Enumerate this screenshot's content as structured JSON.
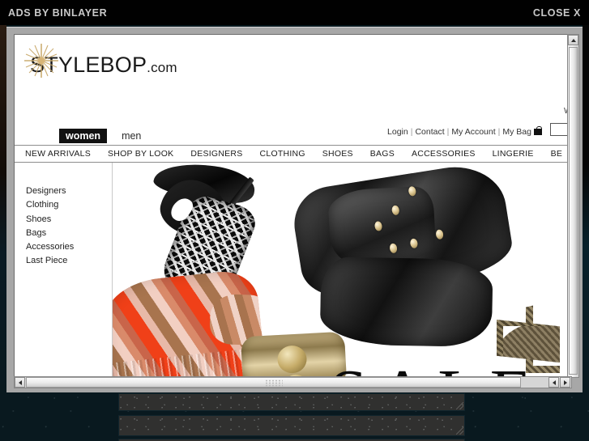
{
  "ad_bar": {
    "label": "ADS BY BINLAYER",
    "close_label": "CLOSE X"
  },
  "site": {
    "logo_name": "STYLEBOP",
    "logo_suffix": ".com",
    "gender_tabs": [
      {
        "label": "women",
        "active": true
      },
      {
        "label": "men",
        "active": false
      }
    ],
    "util_links": [
      {
        "label": "Login"
      },
      {
        "label": "Contact"
      },
      {
        "label": "My Account"
      },
      {
        "label": "My Bag"
      }
    ],
    "separator": "|",
    "search_value": "",
    "welcome_fragment": "W",
    "nav_items": [
      {
        "label": "NEW ARRIVALS"
      },
      {
        "label": "SHOP BY LOOK"
      },
      {
        "label": "DESIGNERS"
      },
      {
        "label": "CLOTHING"
      },
      {
        "label": "SHOES"
      },
      {
        "label": "BAGS"
      },
      {
        "label": "ACCESSORIES"
      },
      {
        "label": "LINGERIE"
      },
      {
        "label": "BE"
      }
    ],
    "side_nav": [
      {
        "label": "Designers"
      },
      {
        "label": "Clothing"
      },
      {
        "label": "Shoes"
      },
      {
        "label": "Bags"
      },
      {
        "label": "Accessories"
      },
      {
        "label": "Last Piece"
      }
    ],
    "hero": {
      "headline": "SALE"
    }
  },
  "colors": {
    "ad_bar_bg": "#010101",
    "ad_bar_text": "#c9c9c9",
    "popup_frame": "#a7a7a7",
    "page_bg": "#09191f",
    "tab_active_bg": "#111111",
    "nav_text": "#1c1c1c"
  }
}
